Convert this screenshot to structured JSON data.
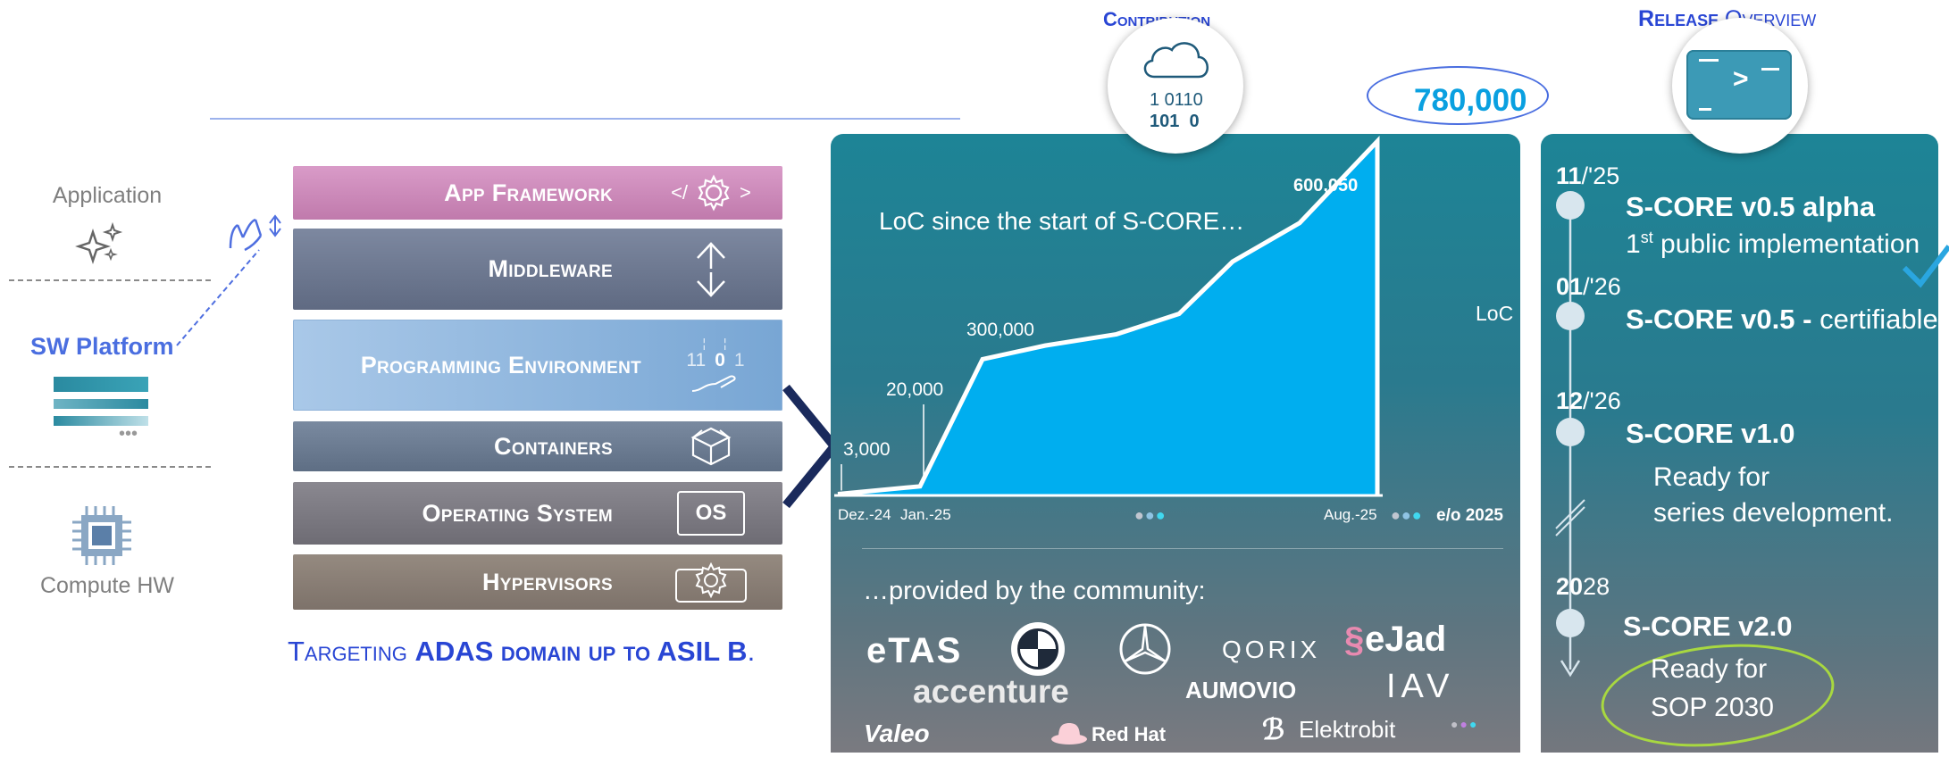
{
  "legend": {
    "application": "Application",
    "sw_platform": "SW Platform",
    "compute_hw": "Compute HW"
  },
  "stack": {
    "layers": [
      {
        "label": "App Framework",
        "color": "#c986b8"
      },
      {
        "label": "Middleware",
        "color": "#6c7890"
      },
      {
        "label": "Programming Environment",
        "color": "#86acd6"
      },
      {
        "label": "Containers",
        "color": "#6f7f90"
      },
      {
        "label": "Operating System",
        "color": "#7d7a80"
      },
      {
        "label": "Hypervisors",
        "color": "#8b7f76"
      }
    ],
    "code_icon_left": "</",
    "code_icon_right": ">",
    "os_icon_label": "OS",
    "prog_digits_1": "11",
    "prog_digits_2": "0",
    "prog_digits_3": "1",
    "targeting_prefix": "Targeting ",
    "targeting_bold1": "ADAS domain up to ASIL B",
    "targeting_suffix": "."
  },
  "contribution": {
    "title": "Contribution",
    "binary_line1": "1 0110",
    "binary_line2": "101  0",
    "total_label": "780,000"
  },
  "chart_data": {
    "type": "area",
    "title": "LoC since the start of S-CORE…",
    "ylabel": "LoC",
    "x_ticks": [
      "Dez.-24",
      "Jan.-25",
      "Aug.-25",
      "e/o 2025"
    ],
    "points": [
      {
        "x": "Dez.-24",
        "y": 3000
      },
      {
        "x": "Jan.-25",
        "y": 20000
      },
      {
        "x": "",
        "y": 300000
      },
      {
        "x": "",
        "y": 330000
      },
      {
        "x": "",
        "y": 355000
      },
      {
        "x": "",
        "y": 400000
      },
      {
        "x": "",
        "y": 515000
      },
      {
        "x": "",
        "y": 600050
      },
      {
        "x": "e/o 2025",
        "y": 780000
      }
    ],
    "data_labels": [
      "3,000",
      "20,000",
      "300,000",
      "600,050"
    ],
    "ylim": [
      0,
      800000
    ],
    "fill_color": "#00aeef",
    "line_color": "#ffffff"
  },
  "community": {
    "title": "…provided by the community:",
    "logos": [
      "eTAS",
      "accenture",
      "QORIX",
      "eJad",
      "AUMOVIO",
      "IAV",
      "Valeo",
      "Red Hat",
      "Elektrobit"
    ]
  },
  "release": {
    "title_bold": "R",
    "title_rest_bold": "elease",
    "title_rest2": "O",
    "title_rest3": "verview",
    "terminal_prompt": ">",
    "items": [
      {
        "date_bold": "11",
        "date_rest": "/'25",
        "title": "S-CORE v0.5 alpha",
        "sub_sup": "st",
        "sub_pre": "1",
        "sub": " public implementation"
      },
      {
        "date_bold": "01",
        "date_rest": "/'26",
        "title": "S-CORE v0.5 -",
        "title_rest": " certifiable"
      },
      {
        "date_bold": "12",
        "date_rest": "/'26",
        "title": "S-CORE v1.0",
        "sub1": "Ready for",
        "sub2": "series development."
      },
      {
        "date_bold": "20",
        "date_rest": "28",
        "title": "S-CORE v2.0",
        "sub1": "Ready for",
        "sub2": "SOP 2030"
      }
    ]
  }
}
